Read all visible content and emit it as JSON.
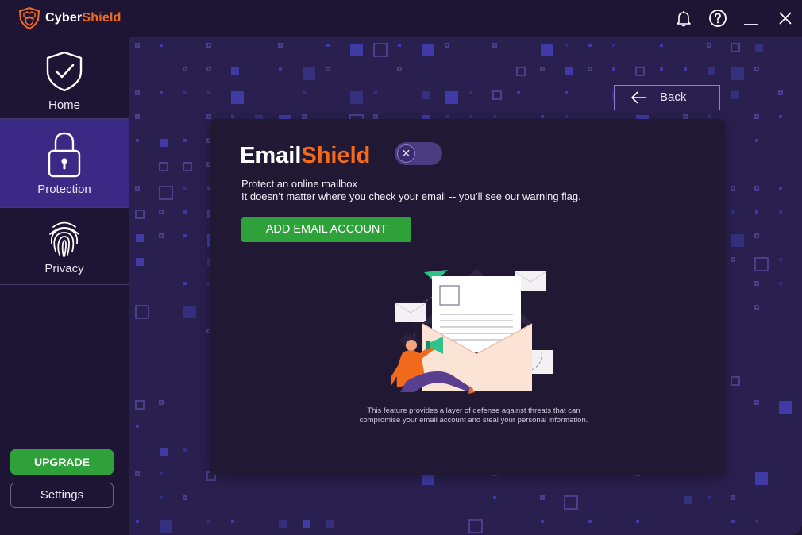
{
  "app": {
    "brand_part1": "Cyber",
    "brand_part2": "Shield"
  },
  "titlebar": {
    "icons": [
      "bell-icon",
      "help-icon",
      "minimize-icon",
      "close-icon"
    ]
  },
  "sidebar": {
    "items": [
      {
        "label": "Home",
        "icon": "shield-check-icon",
        "active": false
      },
      {
        "label": "Protection",
        "icon": "lock-icon",
        "active": true
      },
      {
        "label": "Privacy",
        "icon": "fingerprint-icon",
        "active": false
      }
    ],
    "upgrade_label": "UPGRADE",
    "settings_label": "Settings"
  },
  "main": {
    "back_label": "Back",
    "card": {
      "title_part1": "Email",
      "title_part2": "Shield",
      "toggle_on": false,
      "toggle_symbol": "✕",
      "line1": "Protect an online mailbox",
      "line2": "It doesn’t matter where you check your email -- you’ll see our warning flag.",
      "add_button_label": "ADD EMAIL ACCOUNT",
      "footnote_line1": "This feature provides a layer of defense against threats that can",
      "footnote_line2": "compromise your email account and steal your personal information."
    }
  },
  "colors": {
    "accent_orange": "#f26b1d",
    "green_button": "#2ea13a",
    "active_nav": "#3a2a86",
    "background": "#2a2050"
  }
}
